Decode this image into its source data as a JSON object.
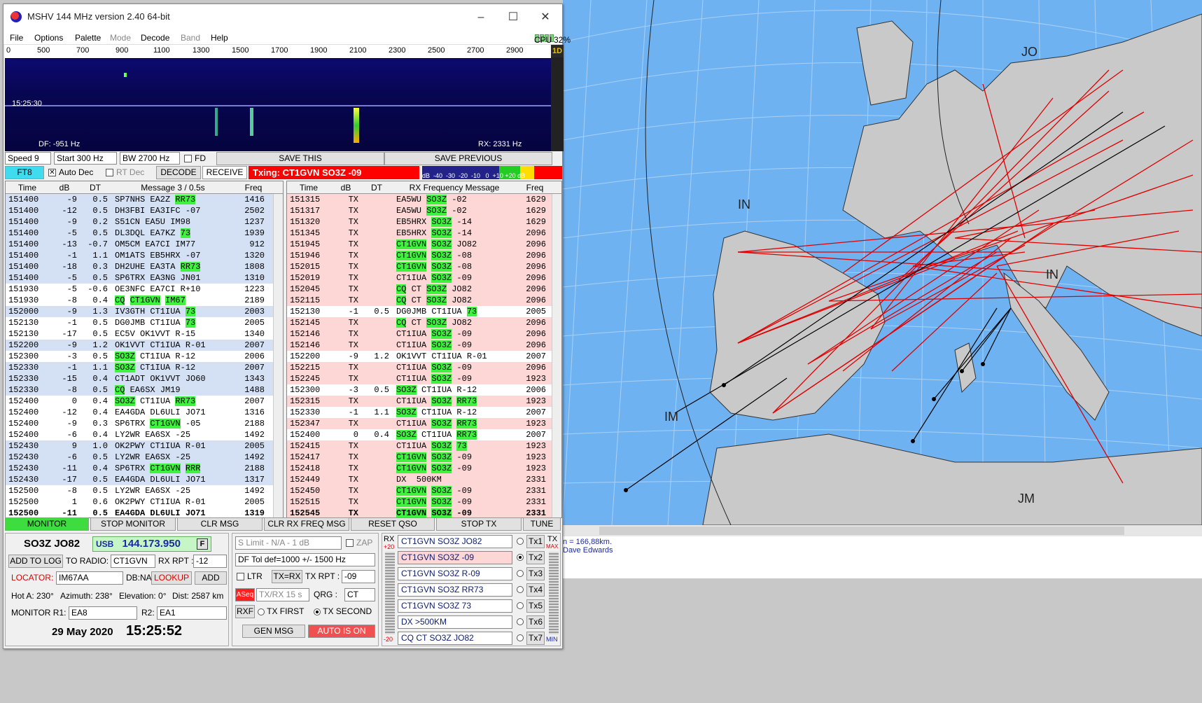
{
  "window": {
    "title": "MSHV 144 MHz version 2.40 64-bit",
    "minimize": "–",
    "maximize": "☐",
    "close": "✕"
  },
  "menu": {
    "file": "File",
    "options": "Options",
    "palette": "Palette",
    "mode": "Mode",
    "decode": "Decode",
    "band": "Band",
    "help": "Help",
    "cpu_label": "CPU 1-4:",
    "cpu_value": "32%"
  },
  "waterfall": {
    "ruler": [
      "0",
      "500",
      "700",
      "900",
      "1100",
      "1300",
      "1500",
      "1700",
      "1900",
      "2100",
      "2300",
      "2500",
      "2700",
      "2900"
    ],
    "time": "15:25:30",
    "df": "DF: -951 Hz",
    "rx": "RX: 2331 Hz",
    "mode_side": "1D"
  },
  "controls": {
    "speed": "Speed 9",
    "start": "Start 300 Hz",
    "bw": "BW 2700 Hz",
    "fd": "FD",
    "save_this": "SAVE THIS",
    "save_previous": "SAVE PREVIOUS",
    "mode": "FT8",
    "auto_dec": "Auto Dec",
    "rt_dec": "RT Dec",
    "decode": "DECODE",
    "receive": "RECEIVE",
    "txing": "Txing: CT1GVN SO3Z -09",
    "meter_scale": "dB  -40  -30  -20  -10   0  +10 +20 dB"
  },
  "left_table": {
    "headers": [
      "Time",
      "dB",
      "DT",
      "Message 3 / 0.5s",
      "Freq"
    ],
    "rows": [
      {
        "t": "151400",
        "db": "-9",
        "dt": "0.5",
        "m": [
          {
            "x": "SP7NHS EA2Z "
          },
          {
            "h": "RR73"
          }
        ],
        "f": "1416",
        "c": "blue"
      },
      {
        "t": "151400",
        "db": "-12",
        "dt": "0.5",
        "m": [
          {
            "x": "DH3FBI EA3IFC -07"
          }
        ],
        "f": "2502",
        "c": "blue"
      },
      {
        "t": "151400",
        "db": "-9",
        "dt": "0.2",
        "m": [
          {
            "x": "S51CN EA5U IM98"
          }
        ],
        "f": "1237",
        "c": "blue"
      },
      {
        "t": "151400",
        "db": "-5",
        "dt": "0.5",
        "m": [
          {
            "x": "DL3DQL EA7KZ "
          },
          {
            "h": "73"
          }
        ],
        "f": "1939",
        "c": "blue"
      },
      {
        "t": "151400",
        "db": "-13",
        "dt": "-0.7",
        "m": [
          {
            "x": "OM5CM EA7CI IM77"
          }
        ],
        "f": "912",
        "c": "blue"
      },
      {
        "t": "151400",
        "db": "-1",
        "dt": "1.1",
        "m": [
          {
            "x": "OM1ATS EB5HRX -07"
          }
        ],
        "f": "1320",
        "c": "blue"
      },
      {
        "t": "151400",
        "db": "-18",
        "dt": "0.3",
        "m": [
          {
            "x": "DH2UHE EA3TA "
          },
          {
            "h": "RR73"
          }
        ],
        "f": "1808",
        "c": "blue"
      },
      {
        "t": "151400",
        "db": "-5",
        "dt": "0.5",
        "m": [
          {
            "x": "SP6TRX EA3NG JN01"
          }
        ],
        "f": "1310",
        "c": "blue"
      },
      {
        "t": "151930",
        "db": "-5",
        "dt": "-0.6",
        "m": [
          {
            "x": "OE3NFC EA7CI R+10"
          }
        ],
        "f": "1223",
        "c": "white"
      },
      {
        "t": "151930",
        "db": "-8",
        "dt": "0.4",
        "m": [
          {
            "h": "CQ"
          },
          {
            "x": " "
          },
          {
            "h": "CT1GVN"
          },
          {
            "x": " "
          },
          {
            "h": "IM67"
          }
        ],
        "f": "2189",
        "c": "white"
      },
      {
        "t": "152000",
        "db": "-9",
        "dt": "1.3",
        "m": [
          {
            "x": "IV3GTH CT1IUA "
          },
          {
            "h": "73"
          }
        ],
        "f": "2003",
        "c": "blue"
      },
      {
        "t": "152130",
        "db": "-1",
        "dt": "0.5",
        "m": [
          {
            "x": "DG0JMB CT1IUA "
          },
          {
            "h": "73"
          }
        ],
        "f": "2005",
        "c": "white"
      },
      {
        "t": "152130",
        "db": "-17",
        "dt": "0.5",
        "m": [
          {
            "x": "EC5V OK1VVT R-15"
          }
        ],
        "f": "1340",
        "c": "white"
      },
      {
        "t": "152200",
        "db": "-9",
        "dt": "1.2",
        "m": [
          {
            "x": "OK1VVT CT1IUA R-01"
          }
        ],
        "f": "2007",
        "c": "blue"
      },
      {
        "t": "152300",
        "db": "-3",
        "dt": "0.5",
        "m": [
          {
            "h": "SO3Z"
          },
          {
            "x": " CT1IUA R-12"
          }
        ],
        "f": "2006",
        "c": "white"
      },
      {
        "t": "152330",
        "db": "-1",
        "dt": "1.1",
        "m": [
          {
            "h": "SO3Z"
          },
          {
            "x": " CT1IUA R-12"
          }
        ],
        "f": "2007",
        "c": "blue"
      },
      {
        "t": "152330",
        "db": "-15",
        "dt": "0.4",
        "m": [
          {
            "x": "CT1ADT OK1VVT JO60"
          }
        ],
        "f": "1343",
        "c": "blue"
      },
      {
        "t": "152330",
        "db": "-8",
        "dt": "0.5",
        "m": [
          {
            "h": "CQ"
          },
          {
            "x": " EA6SX JM19"
          }
        ],
        "f": "1488",
        "c": "blue"
      },
      {
        "t": "152400",
        "db": "0",
        "dt": "0.4",
        "m": [
          {
            "h": "SO3Z"
          },
          {
            "x": " CT1IUA "
          },
          {
            "h": "RR73"
          }
        ],
        "f": "2007",
        "c": "white"
      },
      {
        "t": "152400",
        "db": "-12",
        "dt": "0.4",
        "m": [
          {
            "x": "EA4GDA DL6ULI JO71"
          }
        ],
        "f": "1316",
        "c": "white"
      },
      {
        "t": "152400",
        "db": "-9",
        "dt": "0.3",
        "m": [
          {
            "x": "SP6TRX "
          },
          {
            "h": "CT1GVN"
          },
          {
            "x": " -05"
          }
        ],
        "f": "2188",
        "c": "white"
      },
      {
        "t": "152400",
        "db": "-6",
        "dt": "0.4",
        "m": [
          {
            "x": "LY2WR EA6SX -25"
          }
        ],
        "f": "1492",
        "c": "white"
      },
      {
        "t": "152430",
        "db": "9",
        "dt": "1.0",
        "m": [
          {
            "x": "OK2PWY CT1IUA R-01"
          }
        ],
        "f": "2005",
        "c": "blue"
      },
      {
        "t": "152430",
        "db": "-6",
        "dt": "0.5",
        "m": [
          {
            "x": "LY2WR EA6SX -25"
          }
        ],
        "f": "1492",
        "c": "blue"
      },
      {
        "t": "152430",
        "db": "-11",
        "dt": "0.4",
        "m": [
          {
            "x": "SP6TRX "
          },
          {
            "h": "CT1GVN"
          },
          {
            "x": " "
          },
          {
            "h": "RRR"
          }
        ],
        "f": "2188",
        "c": "blue"
      },
      {
        "t": "152430",
        "db": "-17",
        "dt": "0.5",
        "m": [
          {
            "x": "EA4GDA DL6ULI JO71"
          }
        ],
        "f": "1317",
        "c": "blue"
      },
      {
        "t": "152500",
        "db": "-8",
        "dt": "0.5",
        "m": [
          {
            "x": "LY2WR EA6SX -25"
          }
        ],
        "f": "1492",
        "c": "white"
      },
      {
        "t": "152500",
        "db": "1",
        "dt": "0.6",
        "m": [
          {
            "x": "OK2PWY CT1IUA R-01"
          }
        ],
        "f": "2005",
        "c": "white"
      },
      {
        "t": "152500",
        "db": "-11",
        "dt": "0.5",
        "m": [
          {
            "x": "EA4GDA DL6ULI JO71"
          }
        ],
        "f": "1319",
        "c": "white",
        "b": true
      }
    ]
  },
  "right_table": {
    "headers": [
      "Time",
      "dB",
      "DT",
      "RX Frequency Message",
      "Freq"
    ],
    "rows": [
      {
        "t": "151315",
        "db": "TX",
        "dt": "",
        "m": [
          {
            "x": "EA5WU "
          },
          {
            "h": "SO3Z"
          },
          {
            "x": " -02"
          }
        ],
        "f": "1629",
        "c": "pink"
      },
      {
        "t": "151317",
        "db": "TX",
        "dt": "",
        "m": [
          {
            "x": "EA5WU "
          },
          {
            "h": "SO3Z"
          },
          {
            "x": " -02"
          }
        ],
        "f": "1629",
        "c": "pink"
      },
      {
        "t": "151320",
        "db": "TX",
        "dt": "",
        "m": [
          {
            "x": "EB5HRX "
          },
          {
            "h": "SO3Z"
          },
          {
            "x": " -14"
          }
        ],
        "f": "1629",
        "c": "pink"
      },
      {
        "t": "151345",
        "db": "TX",
        "dt": "",
        "m": [
          {
            "x": "EB5HRX "
          },
          {
            "h": "SO3Z"
          },
          {
            "x": " -14"
          }
        ],
        "f": "2096",
        "c": "pink"
      },
      {
        "t": "151945",
        "db": "TX",
        "dt": "",
        "m": [
          {
            "h": "CT1GVN"
          },
          {
            "x": " "
          },
          {
            "h": "SO3Z"
          },
          {
            "x": " JO82"
          }
        ],
        "f": "2096",
        "c": "pink"
      },
      {
        "t": "151946",
        "db": "TX",
        "dt": "",
        "m": [
          {
            "h": "CT1GVN"
          },
          {
            "x": " "
          },
          {
            "h": "SO3Z"
          },
          {
            "x": " -08"
          }
        ],
        "f": "2096",
        "c": "pink"
      },
      {
        "t": "152015",
        "db": "TX",
        "dt": "",
        "m": [
          {
            "h": "CT1GVN"
          },
          {
            "x": " "
          },
          {
            "h": "SO3Z"
          },
          {
            "x": " -08"
          }
        ],
        "f": "2096",
        "c": "pink"
      },
      {
        "t": "152019",
        "db": "TX",
        "dt": "",
        "m": [
          {
            "x": "CT1IUA "
          },
          {
            "h": "SO3Z"
          },
          {
            "x": " -09"
          }
        ],
        "f": "2096",
        "c": "pink"
      },
      {
        "t": "152045",
        "db": "TX",
        "dt": "",
        "m": [
          {
            "h": "CQ"
          },
          {
            "x": " CT "
          },
          {
            "h": "SO3Z"
          },
          {
            "x": " JO82"
          }
        ],
        "f": "2096",
        "c": "pink"
      },
      {
        "t": "152115",
        "db": "TX",
        "dt": "",
        "m": [
          {
            "h": "CQ"
          },
          {
            "x": " CT "
          },
          {
            "h": "SO3Z"
          },
          {
            "x": " JO82"
          }
        ],
        "f": "2096",
        "c": "pink"
      },
      {
        "t": "152130",
        "db": "-1",
        "dt": "0.5",
        "m": [
          {
            "x": "DG0JMB CT1IUA "
          },
          {
            "h": "73"
          }
        ],
        "f": "2005",
        "c": "white"
      },
      {
        "t": "152145",
        "db": "TX",
        "dt": "",
        "m": [
          {
            "h": "CQ"
          },
          {
            "x": " CT "
          },
          {
            "h": "SO3Z"
          },
          {
            "x": " JO82"
          }
        ],
        "f": "2096",
        "c": "pink"
      },
      {
        "t": "152146",
        "db": "TX",
        "dt": "",
        "m": [
          {
            "x": "CT1IUA "
          },
          {
            "h": "SO3Z"
          },
          {
            "x": " -09"
          }
        ],
        "f": "2096",
        "c": "pink"
      },
      {
        "t": "152146",
        "db": "TX",
        "dt": "",
        "m": [
          {
            "x": "CT1IUA "
          },
          {
            "h": "SO3Z"
          },
          {
            "x": " -09"
          }
        ],
        "f": "2096",
        "c": "pink"
      },
      {
        "t": "152200",
        "db": "-9",
        "dt": "1.2",
        "m": [
          {
            "x": "OK1VVT CT1IUA R-01"
          }
        ],
        "f": "2007",
        "c": "white"
      },
      {
        "t": "152215",
        "db": "TX",
        "dt": "",
        "m": [
          {
            "x": "CT1IUA "
          },
          {
            "h": "SO3Z"
          },
          {
            "x": " -09"
          }
        ],
        "f": "2096",
        "c": "pink"
      },
      {
        "t": "152245",
        "db": "TX",
        "dt": "",
        "m": [
          {
            "x": "CT1IUA "
          },
          {
            "h": "SO3Z"
          },
          {
            "x": " -09"
          }
        ],
        "f": "1923",
        "c": "pink"
      },
      {
        "t": "152300",
        "db": "-3",
        "dt": "0.5",
        "m": [
          {
            "h": "SO3Z"
          },
          {
            "x": " CT1IUA R-12"
          }
        ],
        "f": "2006",
        "c": "white"
      },
      {
        "t": "152315",
        "db": "TX",
        "dt": "",
        "m": [
          {
            "x": "CT1IUA "
          },
          {
            "h": "SO3Z"
          },
          {
            "x": " "
          },
          {
            "h": "RR73"
          }
        ],
        "f": "1923",
        "c": "pink"
      },
      {
        "t": "152330",
        "db": "-1",
        "dt": "1.1",
        "m": [
          {
            "h": "SO3Z"
          },
          {
            "x": " CT1IUA R-12"
          }
        ],
        "f": "2007",
        "c": "white"
      },
      {
        "t": "152347",
        "db": "TX",
        "dt": "",
        "m": [
          {
            "x": "CT1IUA "
          },
          {
            "h": "SO3Z"
          },
          {
            "x": " "
          },
          {
            "h": "RR73"
          }
        ],
        "f": "1923",
        "c": "pink"
      },
      {
        "t": "152400",
        "db": "0",
        "dt": "0.4",
        "m": [
          {
            "h": "SO3Z"
          },
          {
            "x": " CT1IUA "
          },
          {
            "h": "RR73"
          }
        ],
        "f": "2007",
        "c": "white"
      },
      {
        "t": "152415",
        "db": "TX",
        "dt": "",
        "m": [
          {
            "x": "CT1IUA "
          },
          {
            "h": "SO3Z"
          },
          {
            "x": " "
          },
          {
            "h": "73"
          }
        ],
        "f": "1923",
        "c": "pink"
      },
      {
        "t": "152417",
        "db": "TX",
        "dt": "",
        "m": [
          {
            "h": "CT1GVN"
          },
          {
            "x": " "
          },
          {
            "h": "SO3Z"
          },
          {
            "x": " -09"
          }
        ],
        "f": "1923",
        "c": "pink"
      },
      {
        "t": "152418",
        "db": "TX",
        "dt": "",
        "m": [
          {
            "h": "CT1GVN"
          },
          {
            "x": " "
          },
          {
            "h": "SO3Z"
          },
          {
            "x": " -09"
          }
        ],
        "f": "1923",
        "c": "pink"
      },
      {
        "t": "152449",
        "db": "TX",
        "dt": "",
        "m": [
          {
            "x": "DX  500KM"
          }
        ],
        "f": "2331",
        "c": "pink"
      },
      {
        "t": "152450",
        "db": "TX",
        "dt": "",
        "m": [
          {
            "h": "CT1GVN"
          },
          {
            "x": " "
          },
          {
            "h": "SO3Z"
          },
          {
            "x": " -09"
          }
        ],
        "f": "2331",
        "c": "pink"
      },
      {
        "t": "152515",
        "db": "TX",
        "dt": "",
        "m": [
          {
            "h": "CT1GVN"
          },
          {
            "x": " "
          },
          {
            "h": "SO3Z"
          },
          {
            "x": " -09"
          }
        ],
        "f": "2331",
        "c": "pink"
      },
      {
        "t": "152545",
        "db": "TX",
        "dt": "",
        "m": [
          {
            "h": "CT1GVN"
          },
          {
            "x": " "
          },
          {
            "h": "SO3Z"
          },
          {
            "x": " -09"
          }
        ],
        "f": "2331",
        "c": "pink",
        "b": true
      }
    ]
  },
  "buttons": {
    "monitor": "MONITOR",
    "stop_monitor": "STOP MONITOR",
    "clr_msg": "CLR MSG",
    "clr_rx": "CLR RX FREQ MSG",
    "reset_qso": "RESET QSO",
    "stop_tx": "STOP TX",
    "tune": "TUNE"
  },
  "station": {
    "call": "SO3Z JO82",
    "mode": "USB",
    "freq": "144.173.950",
    "f": "F",
    "add_log": "ADD TO LOG",
    "to_radio": "TO RADIO:",
    "to_radio_val": "CT1GVN",
    "rx_rpt": "RX RPT :",
    "rx_rpt_val": "-12",
    "locator_lbl": "LOCATOR:",
    "locator": "IM67AA",
    "dbna": "DB:NA",
    "lookup": "LOOKUP",
    "add": "ADD",
    "hot": "Hot A: 230°",
    "azimuth": "Azimuth: 238°",
    "elevation": "Elevation: 0°",
    "dist": "Dist: 2587 km",
    "monitor_lbl": "MONITOR R1:",
    "r1": "EA8",
    "r2_lbl": "R2:",
    "r2": "EA1",
    "date": "29 May 2020",
    "time": "15:25:52"
  },
  "mid": {
    "slimit": "S Limit - N/A - 1  dB",
    "zap": "ZAP",
    "dftol": "DF Tol def=1000 +/-  1500  Hz",
    "ltr": "LTR",
    "txrx": "TX=RX",
    "txrpt": "TX RPT :",
    "txrpt_val": "-09",
    "aseq": "ASeq",
    "txrx15": "TX/RX 15  s",
    "qrg": "QRG :",
    "qrg_val": "CT",
    "rxf": "RXF",
    "txfirst": "TX FIRST",
    "txsecond": "TX SECOND",
    "genmsg": "GEN MSG",
    "auto": "AUTO IS ON"
  },
  "txmsgs": {
    "rx_lbl": "RX",
    "rx_top": "+20",
    "rx_bot": "-20",
    "tx_lbl": "TX",
    "max": "MAX",
    "min": "MIN",
    "items": [
      {
        "m": "CT1GVN SO3Z JO82",
        "b": "Tx1"
      },
      {
        "m": "CT1GVN SO3Z -09",
        "b": "Tx2"
      },
      {
        "m": "CT1GVN SO3Z R-09",
        "b": "Tx3"
      },
      {
        "m": "CT1GVN SO3Z RR73",
        "b": "Tx4"
      },
      {
        "m": "CT1GVN SO3Z 73",
        "b": "Tx5"
      },
      {
        "m": "DX >500KM",
        "b": "Tx6"
      },
      {
        "m": "CQ CT SO3Z JO82",
        "b": "Tx7"
      }
    ]
  },
  "map": {
    "labels": [
      "JO",
      "IN",
      "IN",
      "IM",
      "JM"
    ],
    "status1": "n = 166,88km.",
    "status2": "Dave Edwards"
  },
  "colors": {
    "highlight": "#3ff23f",
    "tx_row": "#fdd6d6",
    "rx_row": "#d4e0f4",
    "sea": "#6fb2f2",
    "land": "#c9c9c9",
    "txing": "#ff0000",
    "monitor": "#3fdc3f"
  }
}
